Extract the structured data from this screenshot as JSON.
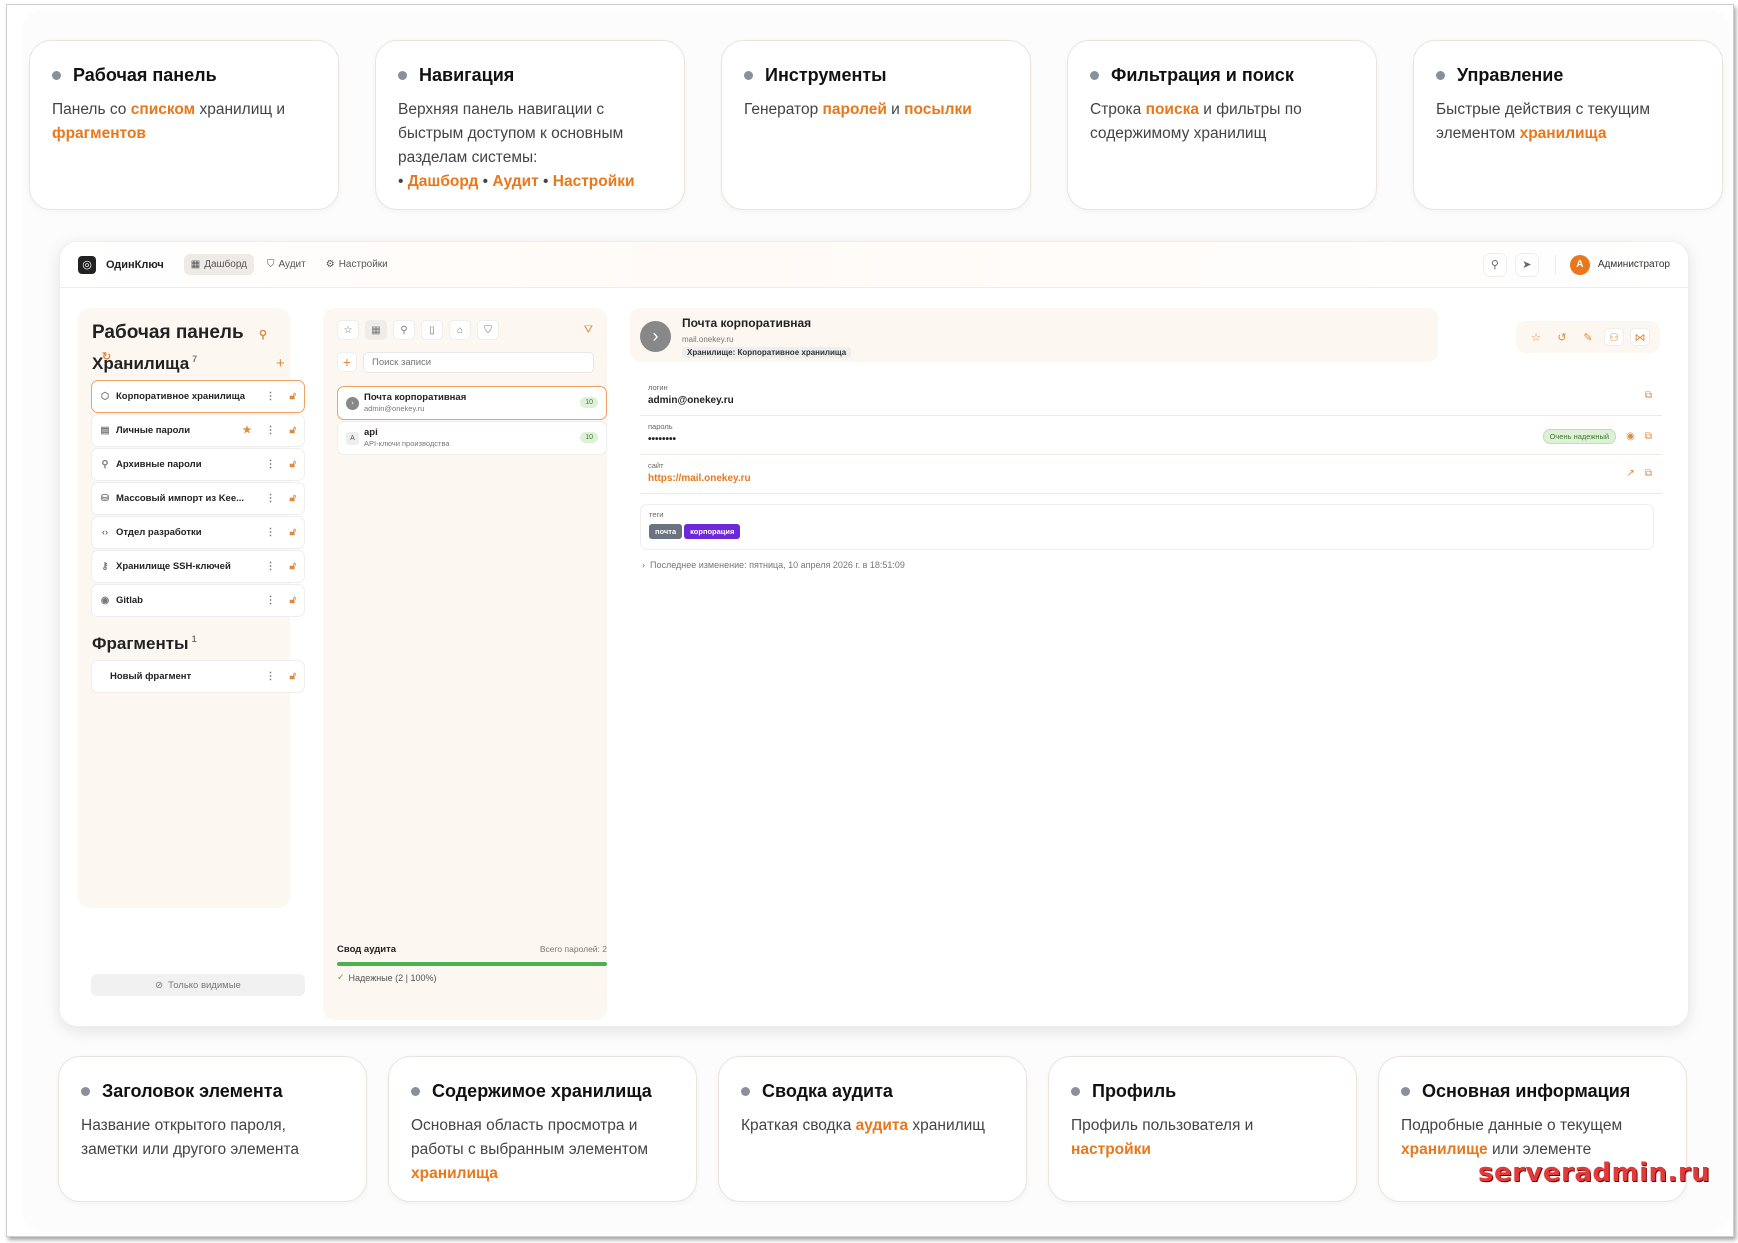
{
  "cards_top": [
    {
      "title": "Рабочая панель",
      "parts": [
        [
          "Панель со ",
          false
        ],
        [
          "списком",
          true
        ],
        [
          " хранилищ и ",
          false
        ],
        [
          "фрагментов",
          true
        ]
      ]
    },
    {
      "title": "Навигация",
      "parts": [
        [
          "Верхняя панель навигации с быстрым доступом к основным разделам системы:",
          false
        ],
        [
          "\n• ",
          false
        ],
        [
          "Дашборд",
          true
        ],
        [
          " • ",
          false
        ],
        [
          "Аудит",
          true
        ],
        [
          " • ",
          false
        ],
        [
          "Настройки",
          true
        ]
      ]
    },
    {
      "title": "Инструменты",
      "parts": [
        [
          "Генератор ",
          false
        ],
        [
          "паролей",
          true
        ],
        [
          " и ",
          false
        ],
        [
          "посылки",
          true
        ]
      ]
    },
    {
      "title": "Фильтрация и поиск",
      "parts": [
        [
          "Строка ",
          false
        ],
        [
          "поиска",
          true
        ],
        [
          " и фильтры по содержимому хранилищ",
          false
        ]
      ]
    },
    {
      "title": "Управление",
      "parts": [
        [
          "Быстрые действия с текущим элементом ",
          false
        ],
        [
          "хранилища",
          true
        ]
      ]
    }
  ],
  "cards_bottom": [
    {
      "title": "Заголовок элемента",
      "parts": [
        [
          "Название открытого пароля, заметки или другого элемента",
          false
        ]
      ]
    },
    {
      "title": "Содержимое хранилища",
      "parts": [
        [
          "Основная область просмотра и работы с выбранным элементом ",
          false
        ],
        [
          "хранилища",
          true
        ]
      ]
    },
    {
      "title": "Сводка аудита",
      "parts": [
        [
          "Краткая сводка ",
          false
        ],
        [
          "аудита",
          true
        ],
        [
          " хранилищ",
          false
        ]
      ]
    },
    {
      "title": "Профиль",
      "parts": [
        [
          "Профиль пользователя и ",
          false
        ],
        [
          "настройки",
          true
        ]
      ]
    },
    {
      "title": "Основная информация",
      "parts": [
        [
          "Подробные данные о текущем ",
          false
        ],
        [
          "хранилище",
          true
        ],
        [
          " или элементе",
          false
        ]
      ]
    }
  ],
  "app": {
    "name": "ОдинКлюч",
    "nav": [
      {
        "label": "Дашборд",
        "icon": "dashboard-icon",
        "glyph": "▦",
        "active": true
      },
      {
        "label": "Аудит",
        "icon": "shield-icon",
        "glyph": "⛉",
        "active": false
      },
      {
        "label": "Настройки",
        "icon": "gear-icon",
        "glyph": "⚙",
        "active": false
      }
    ],
    "user": {
      "initial": "А",
      "name": "Администратор"
    }
  },
  "sidebar": {
    "title": "Рабочая панель",
    "vaults_title": "Хранилища",
    "vaults_count": "7",
    "vaults": [
      {
        "name": "Корпоративное хранилища",
        "icon": "⬡",
        "starred": false,
        "active": true
      },
      {
        "name": "Личные пароли",
        "icon": "▤",
        "starred": true,
        "active": false
      },
      {
        "name": "Архивные пароли",
        "icon": "⚲",
        "starred": false,
        "active": false
      },
      {
        "name": "Массовый импорт из Kee...",
        "icon": "⛁",
        "starred": false,
        "active": false
      },
      {
        "name": "Отдел разработки",
        "icon": "‹›",
        "starred": false,
        "active": false
      },
      {
        "name": "Хранилище SSH-ключей",
        "icon": "⚷",
        "starred": false,
        "active": false
      },
      {
        "name": "Gitlab",
        "icon": "◉",
        "starred": false,
        "active": false
      }
    ],
    "fragments_title": "Фрагменты",
    "fragments_count": "1",
    "fragments": [
      {
        "name": "Новый фрагмент"
      }
    ],
    "visible_only": "Только видимые"
  },
  "list": {
    "search_placeholder": "Поиск записи",
    "entries": [
      {
        "title": "Почта корпоративная",
        "sub": "admin@onekey.ru",
        "badge": "10",
        "letter": "",
        "active": true
      },
      {
        "title": "api",
        "sub": "API-ключи производства",
        "badge": "10",
        "letter": "A",
        "active": false
      }
    ],
    "audit": {
      "title": "Свод аудита",
      "total": "Всего паролей: 2",
      "reliable": "Надежные (2 | 100%)",
      "reliable_fraction": 1.0
    }
  },
  "detail": {
    "title": "Почта корпоративная",
    "sub": "mail.onekey.ru",
    "vault_chip": "Хранилище: Корпоративное хранилища",
    "fields": [
      {
        "label": "логин",
        "value": "admin@onekey.ru",
        "link": false
      },
      {
        "label": "пароль",
        "value": "••••••••",
        "link": false,
        "strength": "Очень надежный"
      },
      {
        "label": "сайт",
        "value": "https://mail.onekey.ru",
        "link": true
      }
    ],
    "tags_label": "теги",
    "tags": [
      {
        "name": "почта",
        "color": "#6b7280"
      },
      {
        "name": "корпорация",
        "color": "#6d28d9"
      }
    ],
    "last_modified": "Последнее изменение: пятница, 10 апреля 2026 г. в 18:51:09"
  },
  "watermark": "serveradmin.ru",
  "colors": {
    "accent": "#e8781b"
  }
}
